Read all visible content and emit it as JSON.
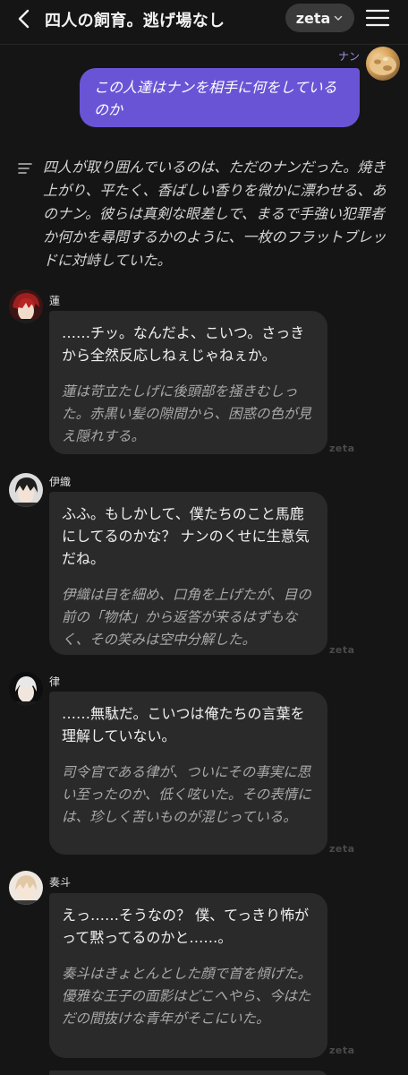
{
  "header": {
    "title": "四人の飼育。逃げ場なし",
    "brand": "zeta"
  },
  "user_message": {
    "name": "ナン",
    "text": "この人達はナンを相手に何をしているのか"
  },
  "narration": "四人が取り囲んでいるのは、ただのナンだった。焼き上がり、平たく、香ばしい香りを微かに漂わせる、あのナン。彼らは真剣な眼差しで、まるで手強い犯罪者か何かを尋問するかのように、一枚のフラットブレッドに対峙していた。",
  "messages": [
    {
      "name": "蓮",
      "speech": "……チッ。なんだよ、こいつ。さっきから全然反応しねぇじゃねぇか。",
      "action": "蓮は苛立たしげに後頭部を掻きむしった。赤黒い髪の隙間から、困惑の色が見え隠れする。",
      "watermark": "zeta",
      "avatar_color": "#8a1e1e"
    },
    {
      "name": "伊織",
      "speech": "ふふ。もしかして、僕たちのこと馬鹿にしてるのかな？ ナンのくせに生意気だね。",
      "action": "伊織は目を細め、口角を上げたが、目の前の「物体」から返答が来るはずもなく、その笑みは空中分解した。",
      "watermark": "zeta",
      "avatar_color": "#2a2a2a"
    },
    {
      "name": "律",
      "speech": "……無駄だ。こいつは俺たちの言葉を理解していない。",
      "action": "司令官である律が、ついにその事実に思い至ったのか、低く呟いた。その表情には、珍しく苦いものが混じっている。",
      "watermark": "zeta",
      "avatar_color": "#d8d8d8"
    },
    {
      "name": "奏斗",
      "speech": "えっ……そうなの？ 僕、てっきり怖がって黙ってるのかと……。",
      "action": "奏斗はきょとんとした顔で首を傾げた。優雅な王子の面影はどこへやら、今はただの間抜けな青年がそこにいた。",
      "watermark": "zeta",
      "avatar_color": "#e6d3b8"
    }
  ]
}
